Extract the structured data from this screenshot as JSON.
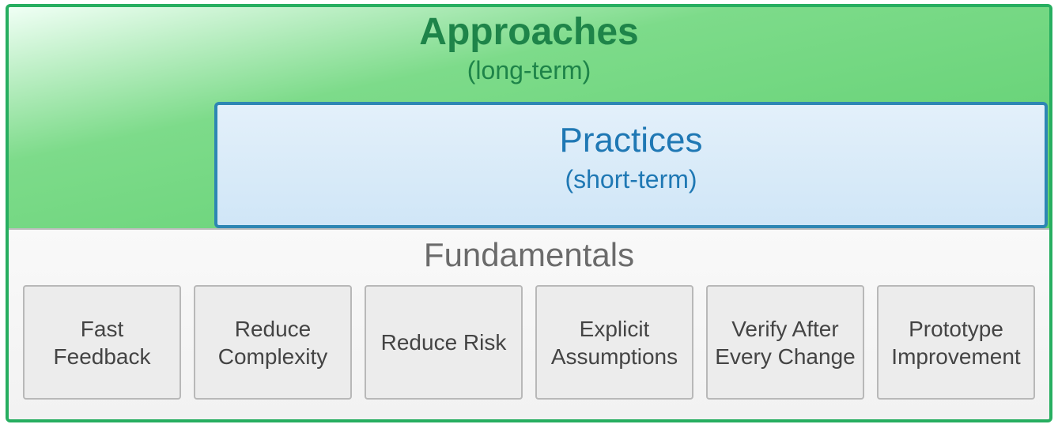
{
  "approaches": {
    "title": "Approaches",
    "subtitle": "(long-term)"
  },
  "practices": {
    "title": "Practices",
    "subtitle": "(short-term)"
  },
  "fundamentals": {
    "title": "Fundamentals",
    "items": [
      "Fast Feedback",
      "Reduce Complexity",
      "Reduce Risk",
      "Explicit Assumptions",
      "Verify After Every Change",
      "Prototype Improvement"
    ]
  }
}
